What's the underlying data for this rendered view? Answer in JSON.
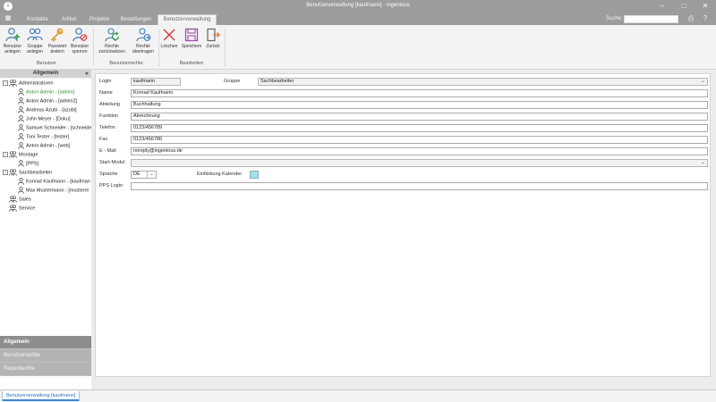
{
  "titlebar": {
    "title": "Benutzerverwaltung [kaufmann] - ingenious",
    "logo": "i",
    "controls": [
      "minimize-icon",
      "maximize-icon",
      "close-icon"
    ]
  },
  "menu": {
    "tabs": [
      "Kontakte",
      "Artikel",
      "Projekte",
      "Bestellungen",
      "Benutzerverwaltung"
    ],
    "active_tab": "Benutzerverwaltung",
    "search_label": "Suche:",
    "search_value": "",
    "right_icons": [
      "print-icon",
      "help-icon"
    ]
  },
  "ribbon": {
    "groups": [
      {
        "label": "Benutzer",
        "buttons": [
          {
            "line1": "Benutzer",
            "line2": "anlegen",
            "icon": "user-add-icon"
          },
          {
            "line1": "Gruppe",
            "line2": "anlegen",
            "icon": "group-add-icon"
          },
          {
            "line1": "Passwort",
            "line2": "ändern",
            "icon": "key-icon"
          },
          {
            "line1": "Benutzer",
            "line2": "sperren",
            "icon": "user-lock-icon"
          }
        ]
      },
      {
        "label": "Benutzerrechte",
        "buttons": [
          {
            "line1": "Rechte",
            "line2": "zurücksetzen",
            "icon": "reset-rights-icon"
          },
          {
            "line1": "Rechte",
            "line2": "übertragen",
            "icon": "transfer-rights-icon"
          }
        ]
      },
      {
        "label": "Bearbeiten",
        "buttons": [
          {
            "line1": "Löschen",
            "line2": "",
            "icon": "delete-icon"
          },
          {
            "line1": "Speichern",
            "line2": "",
            "icon": "save-icon"
          },
          {
            "line1": "Zurück",
            "line2": "",
            "icon": "back-icon"
          }
        ]
      }
    ],
    "colors": {
      "accent_blue": "#3a7ab8",
      "delete_red": "#d93b3b",
      "save_purple": "#a24ea8",
      "key_orange": "#e0a23a"
    }
  },
  "left_panel": {
    "header": "Allgemein",
    "collapse_icon": "double-chevron-left-icon",
    "tree": [
      {
        "label": "Administratoren",
        "level": 0,
        "expander": "−",
        "green": false
      },
      {
        "label": "Anton Admin - [admin]",
        "level": 1,
        "expander": "",
        "green": true
      },
      {
        "label": "Anton Admin - [admin2]",
        "level": 1,
        "expander": "",
        "green": false
      },
      {
        "label": "Andreas Azubi - [azubi]",
        "level": 1,
        "expander": "",
        "green": false
      },
      {
        "label": "John Meyer - [Doku]",
        "level": 1,
        "expander": "",
        "green": false
      },
      {
        "label": "Samuel Schneider - [schneide",
        "level": 1,
        "expander": "",
        "green": false
      },
      {
        "label": "Toni Tester - [tester]",
        "level": 1,
        "expander": "",
        "green": false
      },
      {
        "label": "Anton Admin - [web]",
        "level": 1,
        "expander": "",
        "green": false
      },
      {
        "label": "Montage",
        "level": 0,
        "expander": "−",
        "green": false
      },
      {
        "label": "[PPS]",
        "level": 1,
        "expander": "",
        "green": false
      },
      {
        "label": "Sachbearbeiter",
        "level": 0,
        "expander": "−",
        "green": false
      },
      {
        "label": "Konrad Kaufmann - [kaufman",
        "level": 1,
        "expander": "",
        "green": false
      },
      {
        "label": "Max Mustermann - [musterm",
        "level": 1,
        "expander": "",
        "green": false
      },
      {
        "label": "Sales",
        "level": 0,
        "expander": "",
        "green": false
      },
      {
        "label": "Service",
        "level": 0,
        "expander": "",
        "green": false
      }
    ],
    "nav_buttons": [
      {
        "label": "Allgemein",
        "active": true
      },
      {
        "label": "Benutzerrechte",
        "active": false
      },
      {
        "label": "Reportrechte",
        "active": false
      }
    ]
  },
  "form": {
    "login_label": "Login",
    "login_value": "kaufmann",
    "gruppe_label": "Gruppe",
    "gruppe_value": "Sachbearbeiter",
    "name_label": "Name",
    "name_value": "Konrad Kaufmann",
    "abteilung_label": "Abteilung",
    "abteilung_value": "Buchhaltung",
    "funktion_label": "Funktion",
    "funktion_value": "Abrechnung",
    "telefon_label": "Telefon",
    "telefon_value": "0123/456789",
    "fax_label": "Fax",
    "fax_value": "0123/456780",
    "email_label": "E - Mail",
    "email_value": "noreply@ingenious.de",
    "startmodul_label": "Start-Modul",
    "startmodul_value": "",
    "sprache_label": "Sprache",
    "sprache_value": "DE",
    "kalender_label": "Einfärbung Kalender",
    "kalender_color": "#a6dfe8",
    "pps_label": "PPS Login",
    "pps_value": ""
  },
  "statusbar": {
    "doc_tab": "Benutzerverwaltung [kaufmann]"
  }
}
